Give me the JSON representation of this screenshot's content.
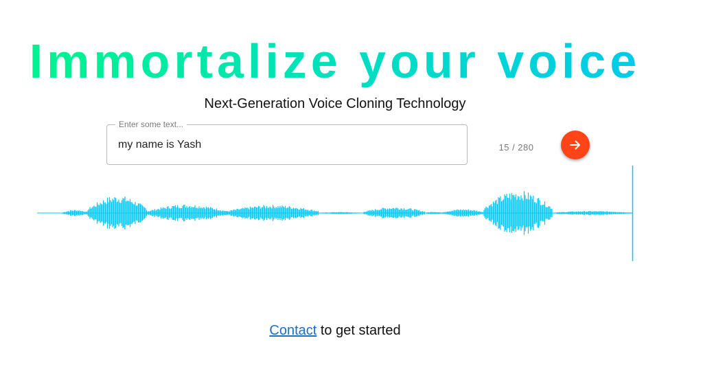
{
  "hero": {
    "title": "Immortalize your voice",
    "subtitle": "Next-Generation Voice Cloning Technology"
  },
  "input": {
    "label": "Enter some text...",
    "value": "my name is Yash",
    "counter": "15 / 280"
  },
  "submit": {
    "icon": "arrow-right-icon"
  },
  "waveform": {
    "color": "#00c8f5"
  },
  "footer": {
    "contact_link": "Contact",
    "contact_suffix": " to get started"
  },
  "colors": {
    "title_gradient_start": "#00f58a",
    "title_gradient_end": "#00c8ee",
    "accent_button": "#ff4417",
    "link": "#1a6fc2"
  }
}
